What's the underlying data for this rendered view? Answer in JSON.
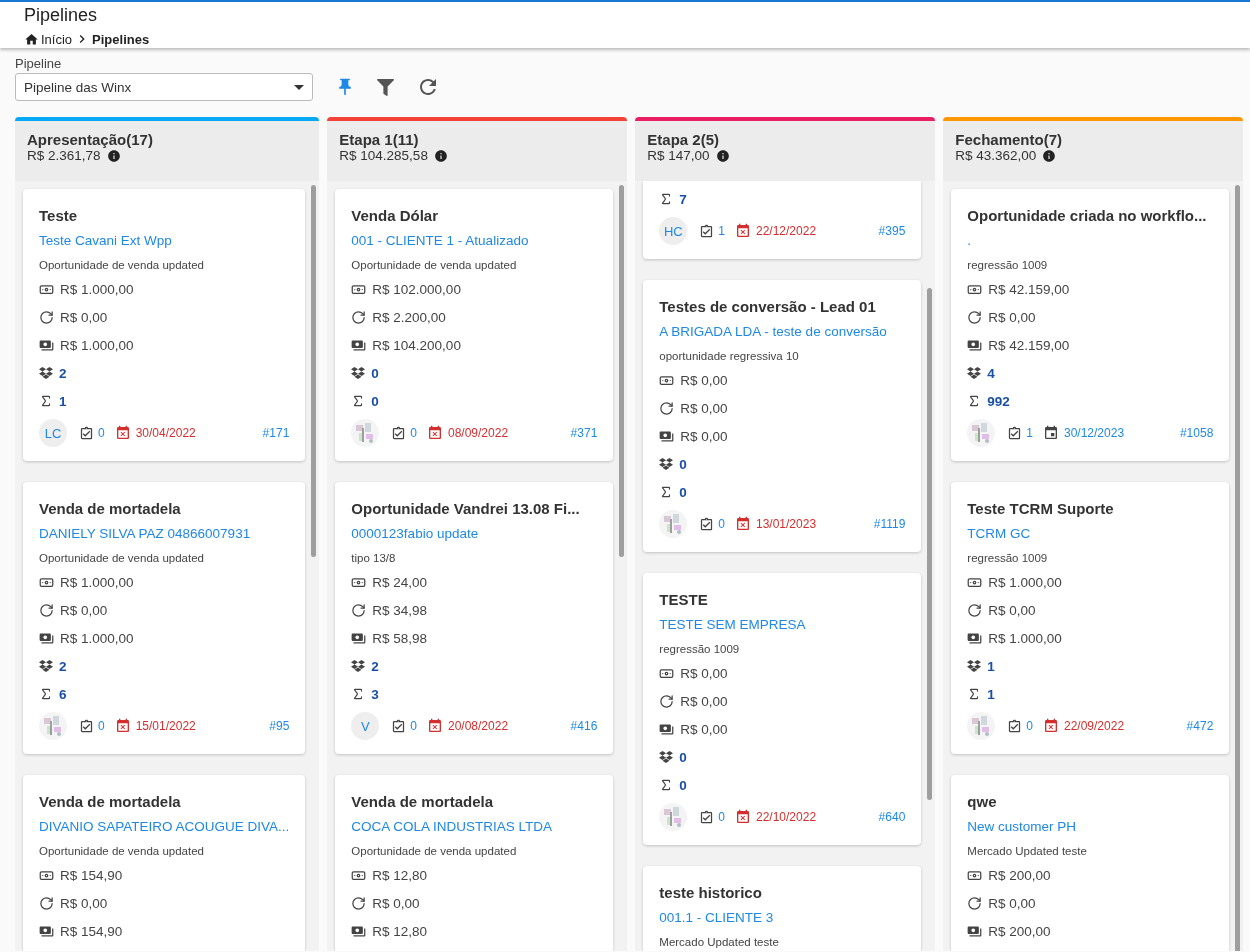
{
  "header": {
    "title": "Pipelines",
    "breadcrumb": [
      {
        "label": "Início",
        "current": false
      },
      {
        "label": "Pipelines",
        "current": true
      }
    ]
  },
  "toolbar": {
    "label": "Pipeline",
    "select_value": "Pipeline das Winx",
    "pinned": true
  },
  "columns": [
    {
      "title": "Apresentação(17)",
      "total": "R$ 2.361,78",
      "color": "#03a9f4",
      "cards": [
        {
          "title": "Teste",
          "company": "Teste Cavani Ext Wpp",
          "description": "Oportunidade de venda updated",
          "values": [
            "R$ 1.000,00",
            "R$ 0,00",
            "R$ 1.000,00"
          ],
          "products": "2",
          "count": "1",
          "avatar": {
            "kind": "initials",
            "text": "LC"
          },
          "tasks": "0",
          "date": "30/04/2022",
          "overdue": true,
          "id": "#171"
        },
        {
          "title": "Venda de mortadela",
          "company": "DANIELY SILVA PAZ 04866007931",
          "description": "Oportunidade de venda updated",
          "values": [
            "R$ 1.000,00",
            "R$ 0,00",
            "R$ 1.000,00"
          ],
          "products": "2",
          "count": "6",
          "avatar": {
            "kind": "picture"
          },
          "tasks": "0",
          "date": "15/01/2022",
          "overdue": true,
          "id": "#95"
        },
        {
          "title": "Venda de mortadela",
          "company": "DIVANIO SAPATEIRO ACOUGUE DIVA...",
          "description": "Oportunidade de venda updated",
          "values": [
            "R$ 154,90",
            "R$ 0,00",
            "R$ 154,90"
          ]
        }
      ]
    },
    {
      "title": "Etapa 1(11)",
      "total": "R$ 104.285,58",
      "color": "#f44336",
      "cards": [
        {
          "title": "Venda Dólar",
          "company": "001 - CLIENTE 1 - Atualizado",
          "description": "Oportunidade de venda updated",
          "values": [
            "R$ 102.000,00",
            "R$ 2.200,00",
            "R$ 104.200,00"
          ],
          "products": "0",
          "count": "0",
          "avatar": {
            "kind": "picture"
          },
          "tasks": "0",
          "date": "08/09/2022",
          "overdue": true,
          "id": "#371"
        },
        {
          "title": "Oportunidade Vandrei 13.08 Fi...",
          "company": "0000123fabio update",
          "description": "tipo 13/8",
          "values": [
            "R$ 24,00",
            "R$ 34,98",
            "R$ 58,98"
          ],
          "products": "2",
          "count": "3",
          "avatar": {
            "kind": "initials",
            "text": "V"
          },
          "tasks": "0",
          "date": "20/08/2022",
          "overdue": true,
          "id": "#416"
        },
        {
          "title": "Venda de mortadela",
          "company": "COCA COLA INDUSTRIAS LTDA",
          "description": "Oportunidade de venda updated",
          "values": [
            "R$ 12,80",
            "R$ 0,00",
            "R$ 12,80"
          ]
        }
      ]
    },
    {
      "title": "Etapa 2(5)",
      "total": "R$ 147,00",
      "color": "#e91e63",
      "cards": [
        {
          "count": "7",
          "avatar": {
            "kind": "initials",
            "text": "HC"
          },
          "tasks": "1",
          "date": "22/12/2022",
          "overdue": true,
          "id": "#395"
        },
        {
          "title": "Testes de conversão - Lead 01",
          "company": "A BRIGADA LDA - teste de conversão",
          "description": "oportunidade regressiva 10",
          "values": [
            "R$ 0,00",
            "R$ 0,00",
            "R$ 0,00"
          ],
          "products": "0",
          "count": "0",
          "avatar": {
            "kind": "picture"
          },
          "tasks": "0",
          "date": "13/01/2023",
          "overdue": true,
          "id": "#1119"
        },
        {
          "title": "TESTE",
          "company": "TESTE SEM EMPRESA",
          "description": "regressão 1009",
          "values": [
            "R$ 0,00",
            "R$ 0,00",
            "R$ 0,00"
          ],
          "products": "0",
          "count": "0",
          "avatar": {
            "kind": "picture"
          },
          "tasks": "0",
          "date": "22/10/2022",
          "overdue": true,
          "id": "#640"
        },
        {
          "title": "teste historico",
          "company": "001.1 - CLIENTE 3",
          "description": "Mercado Updated teste"
        }
      ]
    },
    {
      "title": "Fechamento(7)",
      "total": "R$ 43.362,00",
      "color": "#ff9800",
      "cards": [
        {
          "title": "Oportunidade criada no workflo...",
          "company": ".",
          "description": "regressão 1009",
          "values": [
            "R$ 42.159,00",
            "R$ 0,00",
            "R$ 42.159,00"
          ],
          "products": "4",
          "count": "992",
          "avatar": {
            "kind": "picture"
          },
          "tasks": "1",
          "date": "30/12/2023",
          "overdue": false,
          "id": "#1058"
        },
        {
          "title": "Teste TCRM Suporte",
          "company": "TCRM GC",
          "description": "regressão 1009",
          "values": [
            "R$ 1.000,00",
            "R$ 0,00",
            "R$ 1.000,00"
          ],
          "products": "1",
          "count": "1",
          "avatar": {
            "kind": "picture"
          },
          "tasks": "0",
          "date": "22/09/2022",
          "overdue": true,
          "id": "#472"
        },
        {
          "title": "qwe",
          "company": "New customer PH",
          "description": "Mercado Updated teste",
          "values": [
            "R$ 200,00",
            "R$ 0,00",
            "R$ 200,00"
          ]
        }
      ]
    }
  ]
}
